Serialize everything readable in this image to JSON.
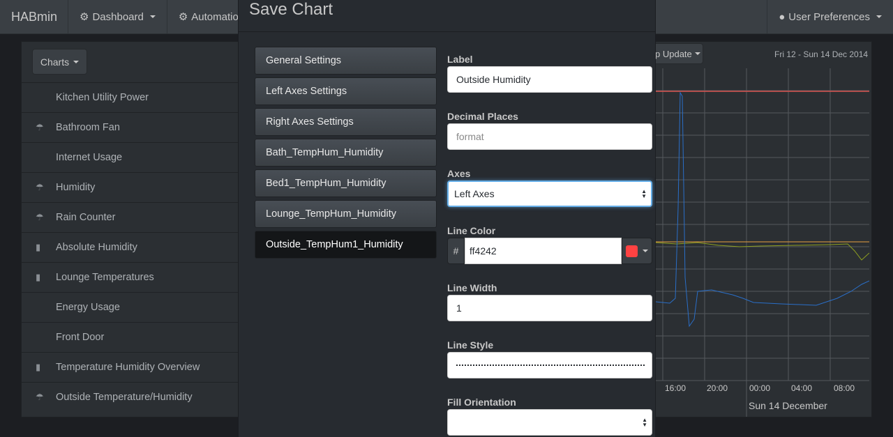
{
  "navbar": {
    "brand": "HABmin",
    "dashboard": "Dashboard",
    "automation": "Automation",
    "user_prefs": "User Preferences"
  },
  "sidebar": {
    "charts_button": "Charts",
    "items": [
      {
        "label": "Kitchen Utility Power",
        "icon": ""
      },
      {
        "label": "Bathroom Fan",
        "icon": "umbrella-icon"
      },
      {
        "label": "Internet Usage",
        "icon": ""
      },
      {
        "label": "Humidity",
        "icon": "umbrella-icon"
      },
      {
        "label": "Rain Counter",
        "icon": "rain-icon"
      },
      {
        "label": "Absolute Humidity",
        "icon": "thermometer-icon"
      },
      {
        "label": "Lounge Temperatures",
        "icon": "thermometer-icon"
      },
      {
        "label": "Energy Usage",
        "icon": ""
      },
      {
        "label": "Front Door",
        "icon": ""
      },
      {
        "label": "Temperature Humidity Overview",
        "icon": "thermometer-icon"
      },
      {
        "label": "Outside Temperature/Humidity",
        "icon": "umbrella-icon"
      }
    ]
  },
  "chart": {
    "update_button": "p Update",
    "date_range": "Fri 12 - Sun 14 Dec 2014",
    "x_ticks": [
      "16:00",
      "20:00",
      "00:00",
      "04:00",
      "08:00"
    ],
    "x_sub_label": "Sun 14 December"
  },
  "modal": {
    "title": "Save Chart",
    "menu": [
      "General Settings",
      "Left Axes Settings",
      "Right Axes Settings",
      "Bath_TempHum_Humidity",
      "Bed1_TempHum_Humidity",
      "Lounge_TempHum_Humidity",
      "Outside_TempHum1_Humidity"
    ],
    "active_index": 6,
    "form": {
      "label_label": "Label",
      "label_value": "Outside Humidity",
      "decimal_label": "Decimal Places",
      "decimal_placeholder": "format",
      "axes_label": "Axes",
      "axes_value": "Left Axes",
      "color_label": "Line Color",
      "color_hash": "#",
      "color_value": "ff4242",
      "color_swatch": "#ff4242",
      "width_label": "Line Width",
      "width_value": "1",
      "style_label": "Line Style",
      "fill_label": "Fill Orientation",
      "fill_value": ""
    }
  },
  "colors": {
    "series_red": "#d9534f",
    "series_orange": "#e8a040",
    "series_green": "#8fa020",
    "series_blue": "#2a6fc9"
  }
}
